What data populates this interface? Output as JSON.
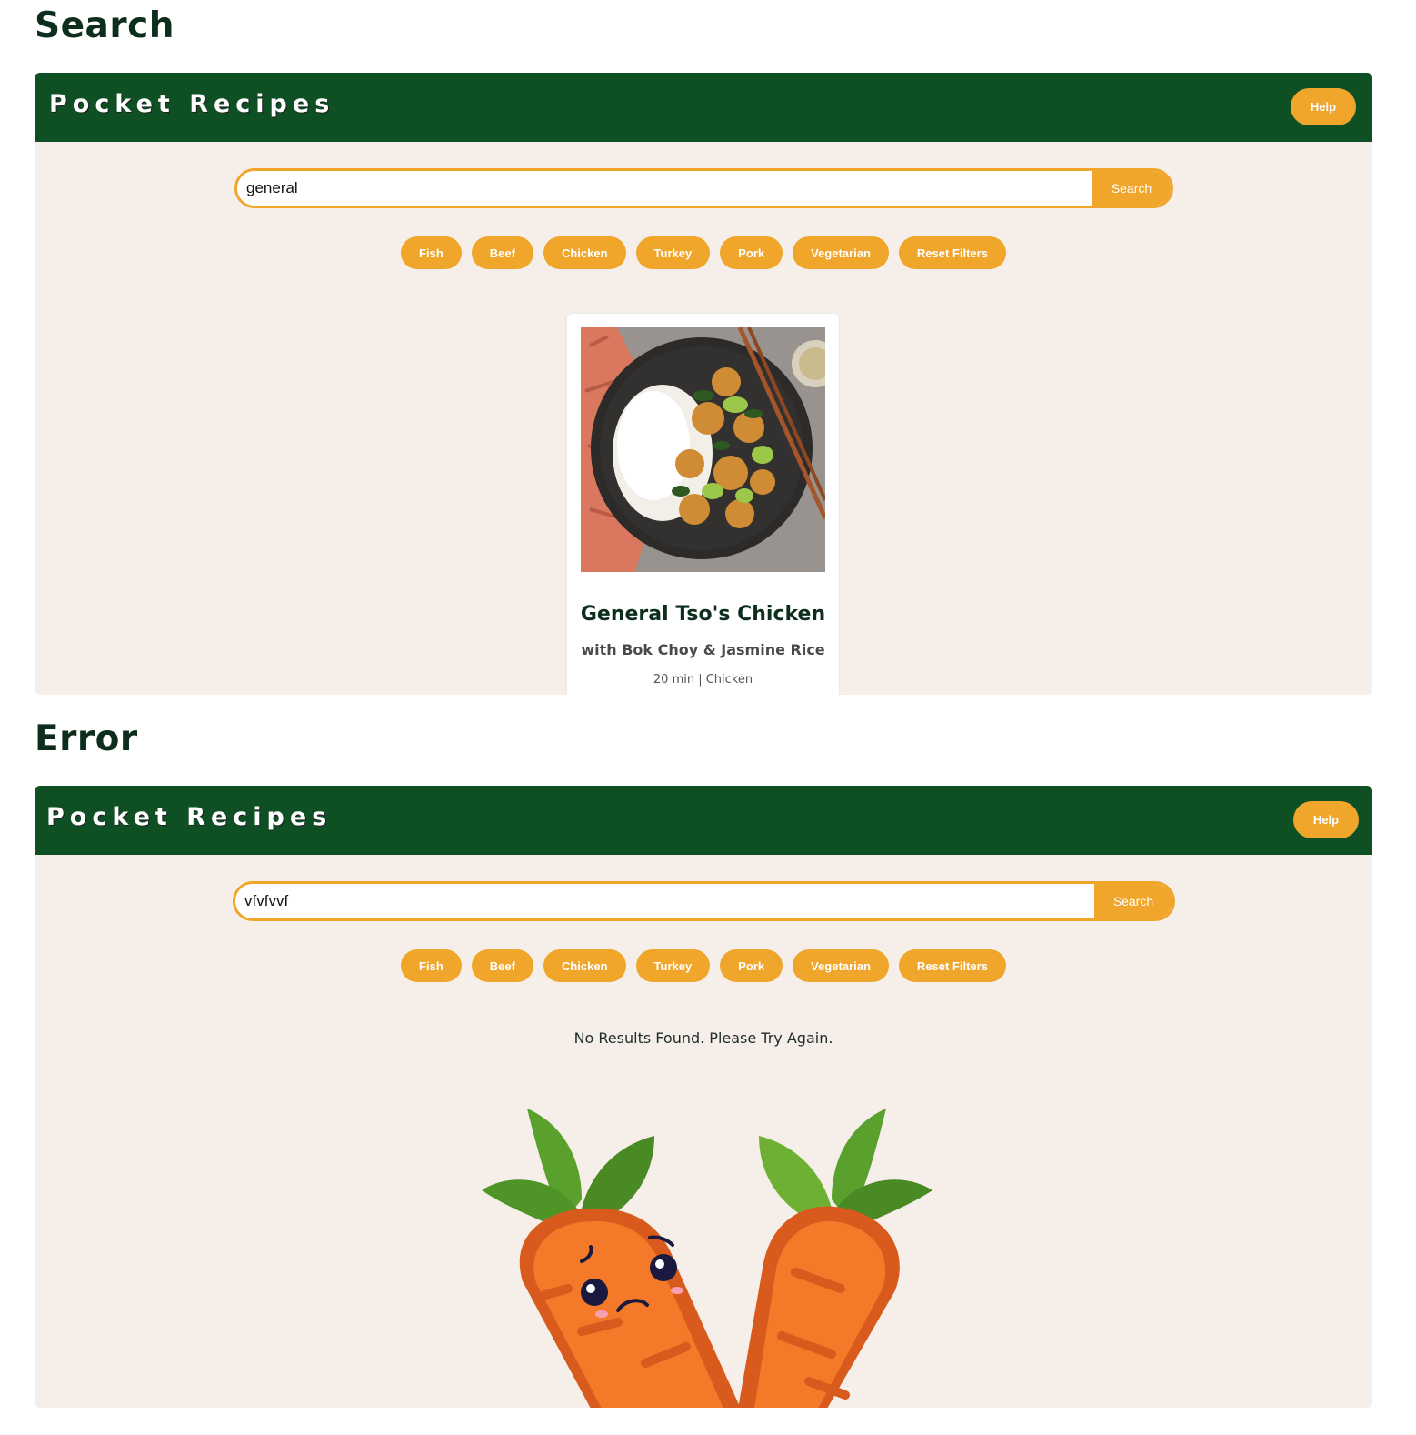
{
  "sections": {
    "search_title": "Search",
    "error_title": "Error"
  },
  "app": {
    "logo": "Pocket Recipes",
    "help_label": "Help"
  },
  "search_view": {
    "query": "general",
    "search_button": "Search",
    "filters": [
      "Fish",
      "Beef",
      "Chicken",
      "Turkey",
      "Pork",
      "Vegetarian",
      "Reset Filters"
    ],
    "result": {
      "title": "General Tso's Chicken",
      "subtitle": "with Bok Choy & Jasmine Rice",
      "meta": "20 min | Chicken"
    }
  },
  "error_view": {
    "query": "vfvfvvf",
    "search_button": "Search",
    "filters": [
      "Fish",
      "Beef",
      "Chicken",
      "Turkey",
      "Pork",
      "Vegetarian",
      "Reset Filters"
    ],
    "message": "No Results Found. Please Try Again."
  },
  "colors": {
    "header": "#0e4f24",
    "accent": "#f0a52b",
    "panel": "#f5eee9",
    "carrot": "#f47a2a",
    "leaf": "#5aa02c"
  }
}
